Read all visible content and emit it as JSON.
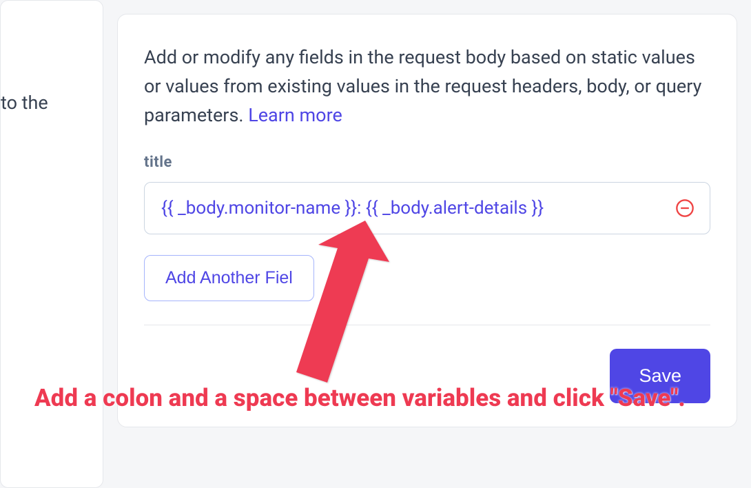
{
  "leftPanel": {
    "fragment": "to the"
  },
  "mainPanel": {
    "description": "Add or modify any fields in the request body based on static values or values from existing values in the request headers, body, or query parameters. ",
    "learnMoreLabel": "Learn more",
    "field": {
      "label": "title",
      "value": "{{ _body.monitor-name }}: {{ _body.alert-details }}"
    },
    "addButtonLabel": "Add Another Fiel",
    "saveButtonLabel": "Save"
  },
  "annotation": {
    "text": "Add a colon and a space between variables and click \"Save\"."
  }
}
